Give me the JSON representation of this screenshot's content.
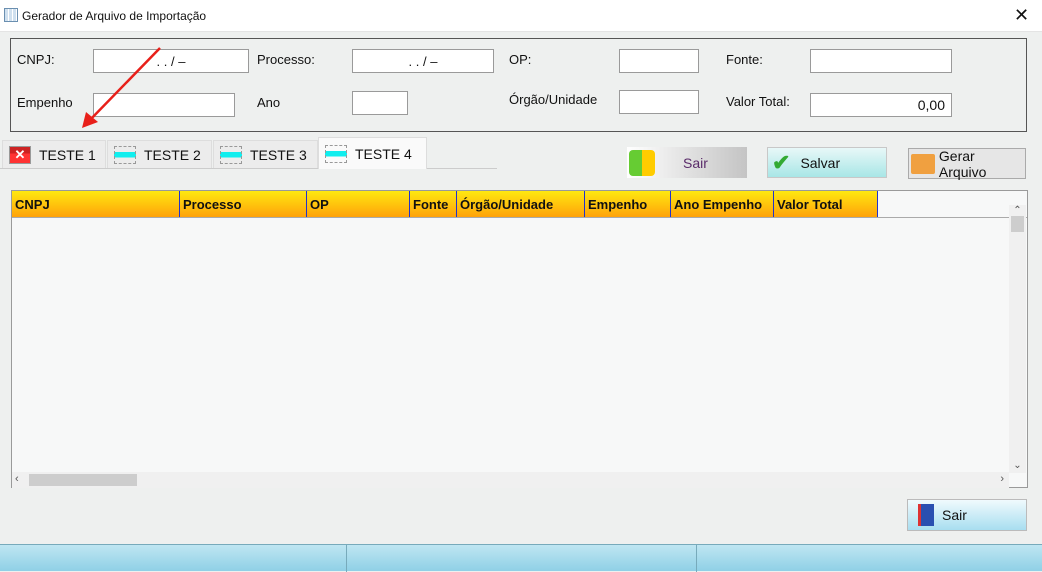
{
  "window": {
    "title": "Gerador de Arquivo de Importação",
    "close": "✕"
  },
  "form": {
    "cnpj_label": "CNPJ:",
    "cnpj_value": ".      .      /      –",
    "processo_label": "Processo:",
    "processo_value": ".      .      /      –",
    "op_label": "OP:",
    "op_value": "",
    "fonte_label": "Fonte:",
    "fonte_value": "",
    "empenho_label": "Empenho",
    "empenho_value": "",
    "ano_label": "Ano",
    "ano_value": "",
    "orgao_label": "Órgão/Unidade",
    "orgao_value": "",
    "valor_label": "Valor Total:",
    "valor_value": "0,00"
  },
  "tabs": [
    {
      "label": "TESTE 1",
      "icon": "close-x-icon"
    },
    {
      "label": "TESTE 2",
      "icon": "printer-icon"
    },
    {
      "label": "TESTE 3",
      "icon": "printer-icon"
    },
    {
      "label": "TESTE 4",
      "icon": "printer-icon",
      "active": true
    }
  ],
  "toolbar": {
    "sair": "Sair",
    "salvar": "Salvar",
    "gerar": "Gerar Arquivo"
  },
  "grid": {
    "columns": [
      "CNPJ",
      "Processo",
      "OP",
      "Fonte",
      "Órgão/Unidade",
      "Empenho",
      "Ano Empenho",
      "Valor Total"
    ],
    "rows": []
  },
  "footer": {
    "sair": "Sair"
  },
  "colors": {
    "header_top": "#ffe810",
    "header_bottom": "#ffa20a",
    "status": "#a8dcec"
  }
}
